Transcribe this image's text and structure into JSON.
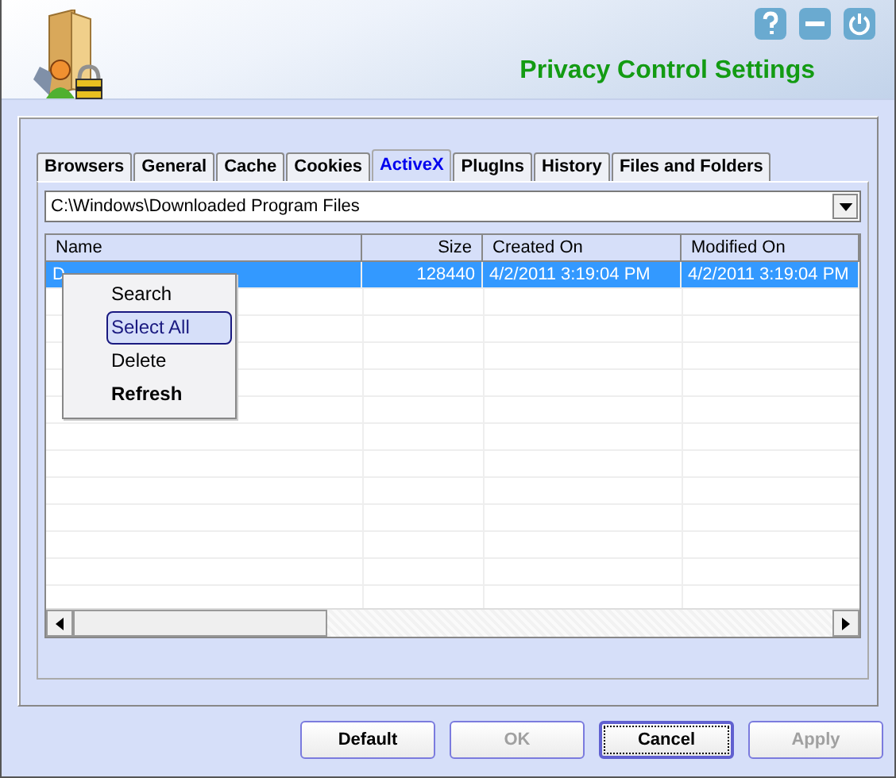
{
  "header": {
    "title": "Privacy Control Settings"
  },
  "tabs": [
    {
      "label": "Browsers",
      "selected": false
    },
    {
      "label": "General",
      "selected": false
    },
    {
      "label": "Cache",
      "selected": false
    },
    {
      "label": "Cookies",
      "selected": false
    },
    {
      "label": "ActiveX",
      "selected": true
    },
    {
      "label": "PlugIns",
      "selected": false
    },
    {
      "label": "History",
      "selected": false
    },
    {
      "label": "Files and Folders",
      "selected": false
    }
  ],
  "folder_select": {
    "value": "C:\\Windows\\Downloaded Program Files"
  },
  "table": {
    "columns": [
      "Name",
      "Size",
      "Created On",
      "Modified On"
    ],
    "rows": [
      {
        "cells": [
          "D",
          "128440",
          "4/2/2011 3:19:04 PM",
          "4/2/2011 3:19:04 PM"
        ],
        "selected": true
      }
    ]
  },
  "context_menu": [
    {
      "label": "Search",
      "selected": false,
      "bold": false
    },
    {
      "label": "Select All",
      "selected": true,
      "bold": false
    },
    {
      "label": "Delete",
      "selected": false,
      "bold": false
    },
    {
      "label": "Refresh",
      "selected": false,
      "bold": true
    }
  ],
  "buttons": [
    {
      "label": "Default",
      "disabled": false,
      "focused": false
    },
    {
      "label": "OK",
      "disabled": true,
      "focused": false
    },
    {
      "label": "Cancel",
      "disabled": false,
      "focused": true
    },
    {
      "label": "Apply",
      "disabled": true,
      "focused": false
    }
  ]
}
